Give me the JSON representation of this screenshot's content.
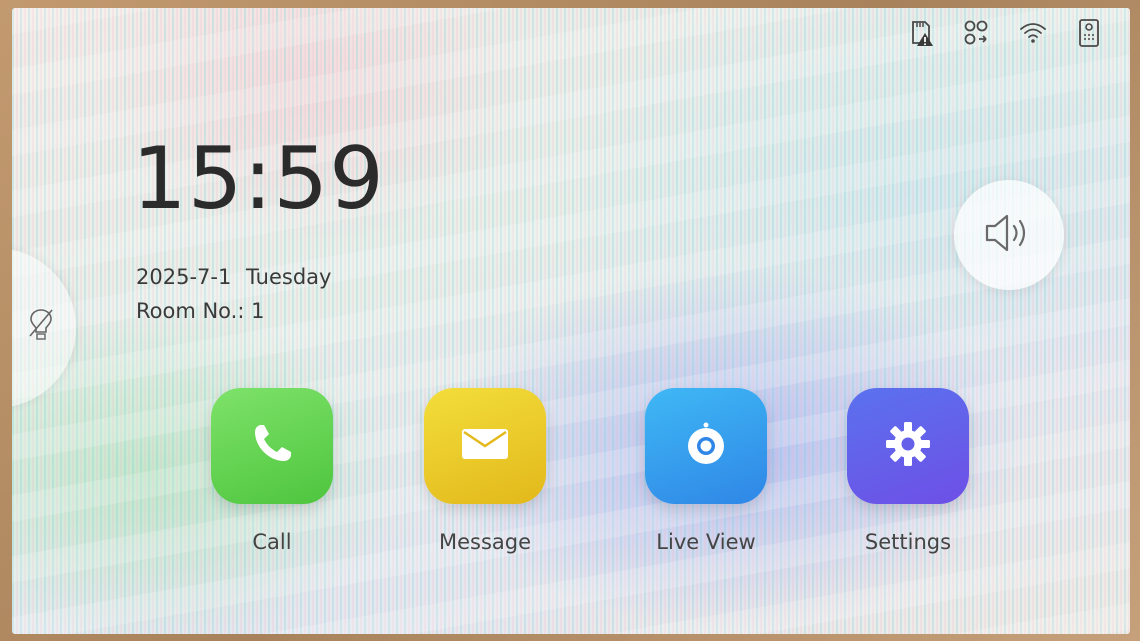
{
  "status_bar": {
    "icons": [
      "sd-card-warning-icon",
      "network-link-icon",
      "wifi-icon",
      "door-station-icon"
    ]
  },
  "clock": {
    "time": "15:59",
    "date": "2025-7-1",
    "weekday": "Tuesday",
    "room": "Room No.: 1"
  },
  "side_tab": {
    "icon": "do-not-disturb-icon"
  },
  "volume": {
    "icon": "speaker-icon"
  },
  "apps": [
    {
      "label": "Call",
      "icon": "phone-icon",
      "color": "#5ccf49"
    },
    {
      "label": "Message",
      "icon": "envelope-icon",
      "color": "#ecc82a"
    },
    {
      "label": "Live View",
      "icon": "camera-icon",
      "color": "#359fef"
    },
    {
      "label": "Settings",
      "icon": "gear-icon",
      "color": "#6460ea"
    }
  ]
}
